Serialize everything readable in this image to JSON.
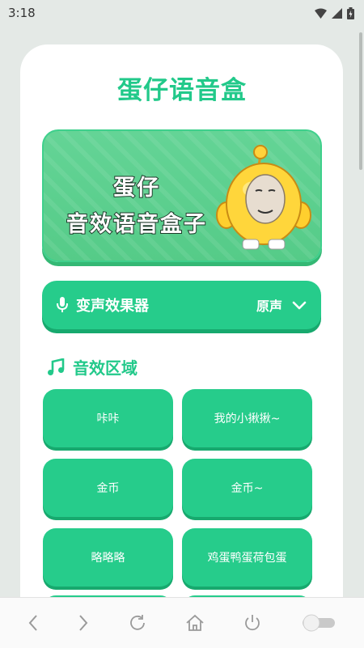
{
  "status_bar": {
    "time": "3:18"
  },
  "app": {
    "title": "蛋仔语音盒"
  },
  "banner": {
    "line1": "蛋仔",
    "line2": "音效语音盒子"
  },
  "voice_changer": {
    "label": "变声效果器",
    "value": "原声"
  },
  "section": {
    "title": "音效区域"
  },
  "sounds": [
    {
      "label": "咔咔"
    },
    {
      "label": "我的小揪揪~"
    },
    {
      "label": "金币"
    },
    {
      "label": "金币~"
    },
    {
      "label": "略略略"
    },
    {
      "label": "鸡蛋鸭蛋荷包蛋"
    }
  ],
  "colors": {
    "accent": "#26cc8b",
    "accent_dark": "#17a96e",
    "title_green": "#22c98a",
    "background": "#e4e9e6"
  },
  "bottom_nav_icons": [
    "back-icon",
    "forward-icon",
    "refresh-icon",
    "home-icon",
    "power-icon",
    "toggle-switch"
  ]
}
